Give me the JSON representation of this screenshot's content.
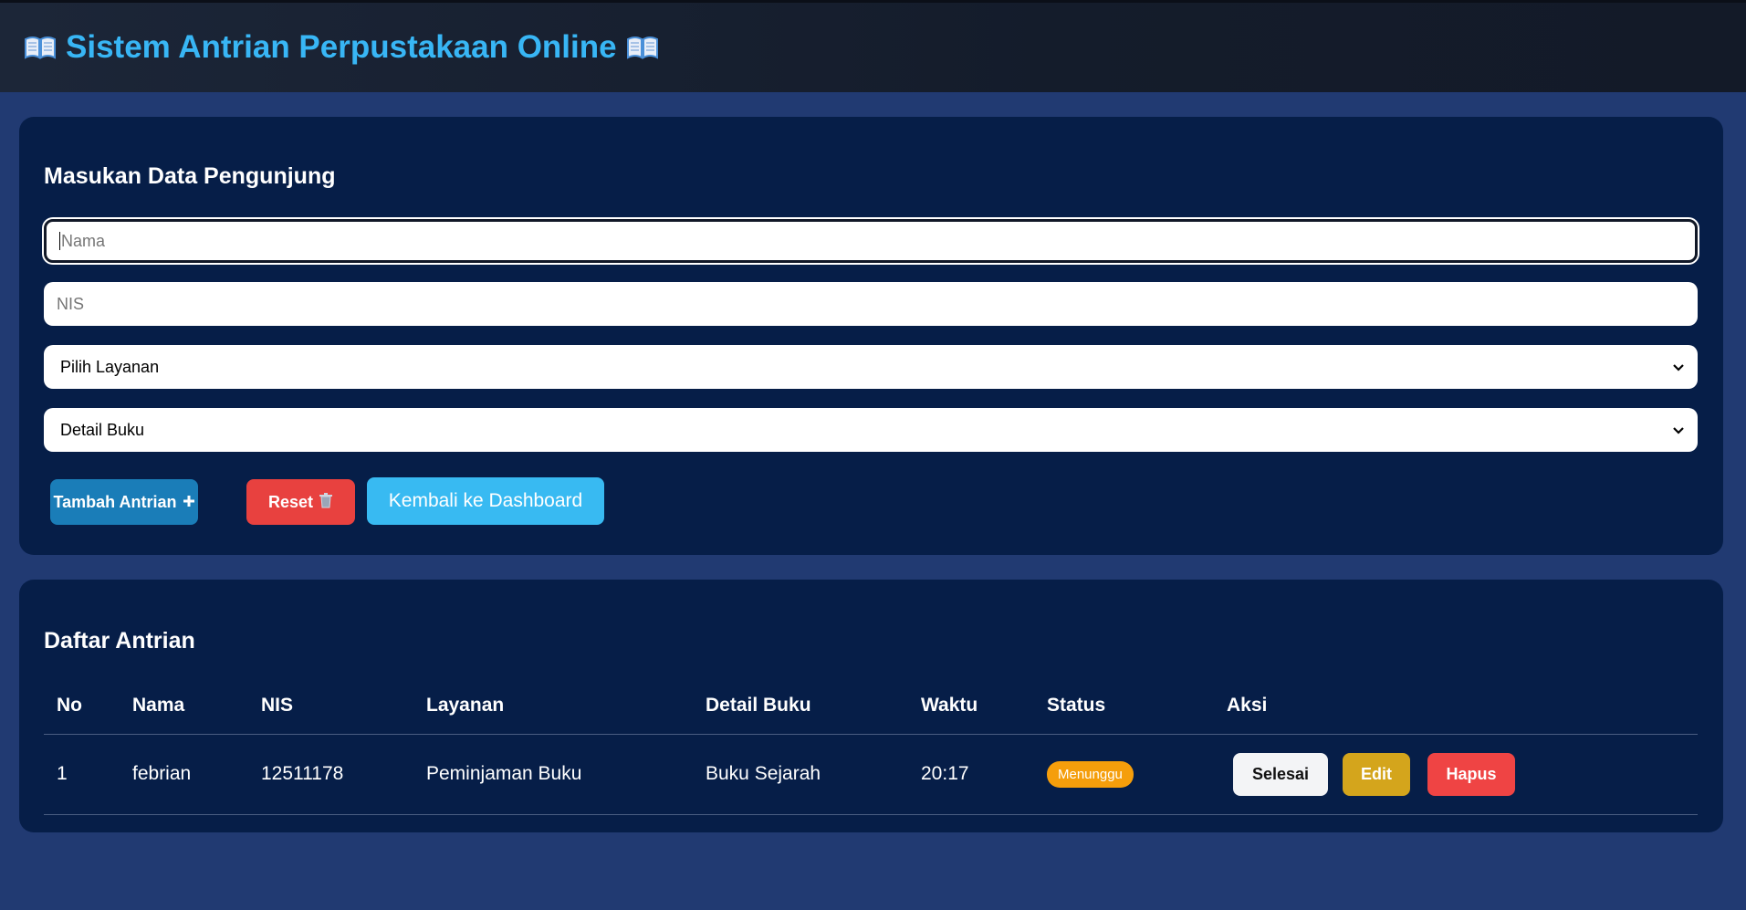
{
  "header": {
    "title": "Sistem Antrian Perpustakaan Online",
    "icon": "open-book-icon"
  },
  "form": {
    "title": "Masukan Data Pengunjung",
    "nama_placeholder": "Nama",
    "nis_placeholder": "NIS",
    "layanan_selected": "Pilih Layanan",
    "detail_selected": "Detail Buku",
    "add_label": "Tambah Antrian",
    "reset_label": "Reset",
    "back_label": "Kembali ke Dashboard"
  },
  "table": {
    "title": "Daftar Antrian",
    "columns": [
      "No",
      "Nama",
      "NIS",
      "Layanan",
      "Detail Buku",
      "Waktu",
      "Status",
      "Aksi"
    ],
    "rows": [
      {
        "no": "1",
        "nama": "febrian",
        "nis": "12511178",
        "layanan": "Peminjaman Buku",
        "detail": "Buku Sejarah",
        "waktu": "20:17",
        "status": "Menunggu",
        "done_label": "Selesai",
        "edit_label": "Edit",
        "delete_label": "Hapus"
      }
    ]
  },
  "colors": {
    "accent": "#38b6f5",
    "background": "#213a72",
    "card": "#061e48",
    "add": "#1a7db8",
    "reset": "#e8413f",
    "status_waiting": "#f59e0b",
    "edit": "#d4a51c",
    "delete": "#ef4444"
  }
}
